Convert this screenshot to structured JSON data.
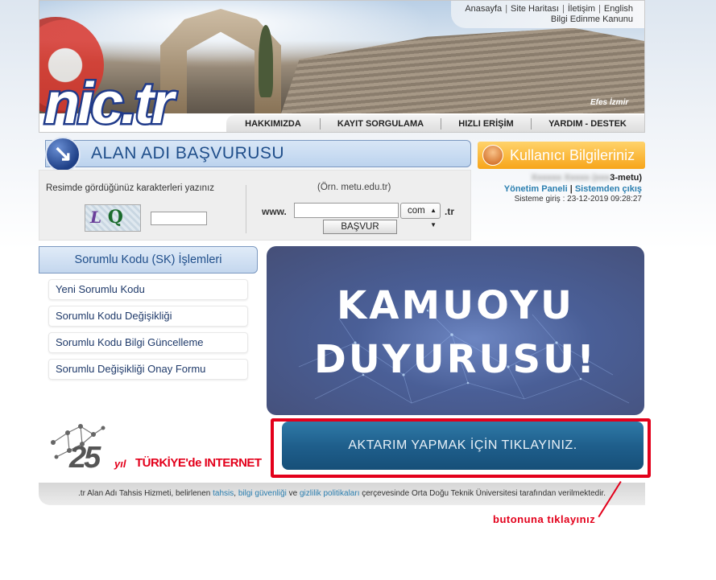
{
  "header": {
    "top_links": [
      "Anasayfa",
      "Site Haritası",
      "İletişim",
      "English"
    ],
    "top_link_row2": "Bilgi Edinme Kanunu",
    "logo_text": "nic.tr",
    "photo_caption": "Efes İzmir",
    "nav": [
      "HAKKIMIZDA",
      "KAYIT SORGULAMA",
      "HIZLI ERİŞİM",
      "YARDIM - DESTEK"
    ]
  },
  "apply": {
    "title": "ALAN ADI BAŞVURUSU",
    "captcha_label": "Resimde gördüğünüz karakterleri yazınız",
    "captcha_text": "Q",
    "captcha_prefix": "L",
    "example": "(Örn. metu.edu.tr)",
    "www_label": "www.",
    "tld_selected": "com",
    "tld_suffix": ".tr",
    "button_label": "BAŞVUR"
  },
  "user": {
    "title": "Kullanıcı Bilgileriniz",
    "name_hidden": "Xxxxxx Xxxxx (xxx",
    "name_suffix": "3-metu)",
    "panel_link": "Yönetim Paneli",
    "logout_link": "Sistemden çıkış",
    "login_time": "Sisteme giriş : 23-12-2019 09:28:27"
  },
  "sk_menu": {
    "title": "Sorumlu Kodu (SK) İşlemleri",
    "items": [
      "Yeni Sorumlu Kodu",
      "Sorumlu Kodu Değişikliği",
      "Sorumlu Kodu Bilgi Güncelleme",
      "Sorumlu Değişikliği Onay Formu"
    ]
  },
  "announcement": {
    "line1": "KAMUOYU",
    "line2": "DUYURUSU!"
  },
  "transfer": {
    "button_label": "AKTARIM YAPMAK İÇİN TIKLAYINIZ."
  },
  "anniversary": {
    "number": "25",
    "yil": "yıl",
    "text": "TÜRKİYE'de INTERNET"
  },
  "footer": {
    "part1": ".tr Alan Adı Tahsis Hizmeti, belirlenen ",
    "link1": "tahsis",
    "sep1": ", ",
    "link2": "bilgi güvenliği",
    "sep2": " ve ",
    "link3": "gizlilik politikaları",
    "part2": " çerçevesinde Orta Doğu Teknik Üniversitesi tarafından verilmektedir."
  },
  "annotation": "butonuna tıklayınız",
  "colors": {
    "brand_blue": "#1f3a8a",
    "link_blue": "#2b7fb0",
    "highlight_red": "#e3001b",
    "user_orange": "#f7a51a"
  }
}
